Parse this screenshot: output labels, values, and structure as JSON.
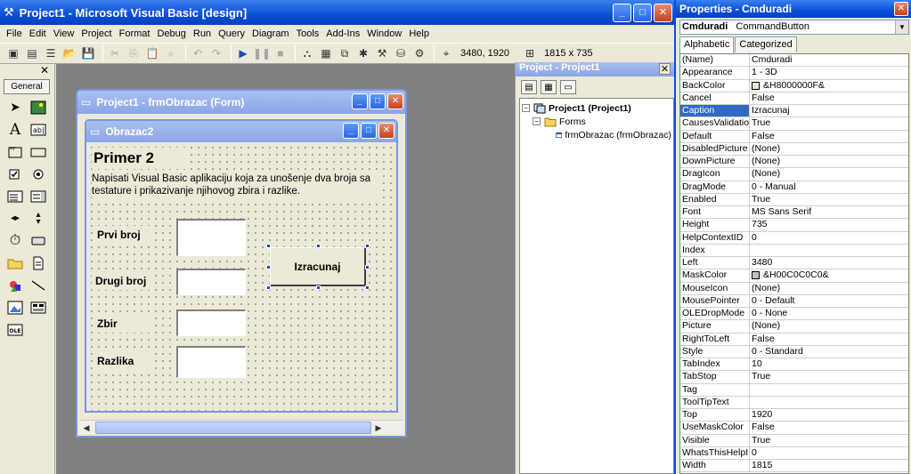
{
  "vb": {
    "title": "Project1 - Microsoft Visual Basic [design]",
    "menu": [
      "File",
      "Edit",
      "View",
      "Project",
      "Format",
      "Debug",
      "Run",
      "Query",
      "Diagram",
      "Tools",
      "Add-Ins",
      "Window",
      "Help"
    ],
    "toolbar": {
      "position": "3480, 1920",
      "size": "1815 x 735"
    }
  },
  "toolbox": {
    "tab": "General"
  },
  "formwin": {
    "title": "Project1 - frmObrazac (Form)"
  },
  "form": {
    "caption": "Obrazac2",
    "heading": "Primer 2",
    "description": "Napisati Visual Basic aplikaciju koja za unošenje dva broja sa testature i prikazivanje njihovog zbira i razlike.",
    "labels": {
      "first": "Prvi broj",
      "second": "Drugi broj",
      "sum": "Zbir",
      "diff": "Razlika"
    },
    "button": "Izracunaj"
  },
  "project": {
    "title": "Project - Project1",
    "root": "Project1 (Project1)",
    "folder": "Forms",
    "item": "frmObrazac (frmObrazac)"
  },
  "properties": {
    "title": "Properties - Cmduradi",
    "object": "Cmduradi",
    "object_type": "CommandButton",
    "tabs": [
      "Alphabetic",
      "Categorized"
    ],
    "selected_row": "Caption",
    "rows": [
      {
        "name": "(Name)",
        "value": "Cmduradi"
      },
      {
        "name": "Appearance",
        "value": "1 - 3D"
      },
      {
        "name": "BackColor",
        "value": "&H8000000F&",
        "swatch": "#ece9d8"
      },
      {
        "name": "Cancel",
        "value": "False"
      },
      {
        "name": "Caption",
        "value": "Izracunaj"
      },
      {
        "name": "CausesValidation",
        "value": "True"
      },
      {
        "name": "Default",
        "value": "False"
      },
      {
        "name": "DisabledPicture",
        "value": "(None)"
      },
      {
        "name": "DownPicture",
        "value": "(None)"
      },
      {
        "name": "DragIcon",
        "value": "(None)"
      },
      {
        "name": "DragMode",
        "value": "0 - Manual"
      },
      {
        "name": "Enabled",
        "value": "True"
      },
      {
        "name": "Font",
        "value": "MS Sans Serif"
      },
      {
        "name": "Height",
        "value": "735"
      },
      {
        "name": "HelpContextID",
        "value": "0"
      },
      {
        "name": "Index",
        "value": ""
      },
      {
        "name": "Left",
        "value": "3480"
      },
      {
        "name": "MaskColor",
        "value": "&H00C0C0C0&",
        "swatch": "#c0c0c0"
      },
      {
        "name": "MouseIcon",
        "value": "(None)"
      },
      {
        "name": "MousePointer",
        "value": "0 - Default"
      },
      {
        "name": "OLEDropMode",
        "value": "0 - None"
      },
      {
        "name": "Picture",
        "value": "(None)"
      },
      {
        "name": "RightToLeft",
        "value": "False"
      },
      {
        "name": "Style",
        "value": "0 - Standard"
      },
      {
        "name": "TabIndex",
        "value": "10"
      },
      {
        "name": "TabStop",
        "value": "True"
      },
      {
        "name": "Tag",
        "value": ""
      },
      {
        "name": "ToolTipText",
        "value": ""
      },
      {
        "name": "Top",
        "value": "1920"
      },
      {
        "name": "UseMaskColor",
        "value": "False"
      },
      {
        "name": "Visible",
        "value": "True"
      },
      {
        "name": "WhatsThisHelpID",
        "value": "0"
      },
      {
        "name": "Width",
        "value": "1815"
      }
    ]
  },
  "colors": {
    "xp_blue": "#0a4ed6",
    "selection": "#316ac5",
    "face": "#ece9d8"
  }
}
